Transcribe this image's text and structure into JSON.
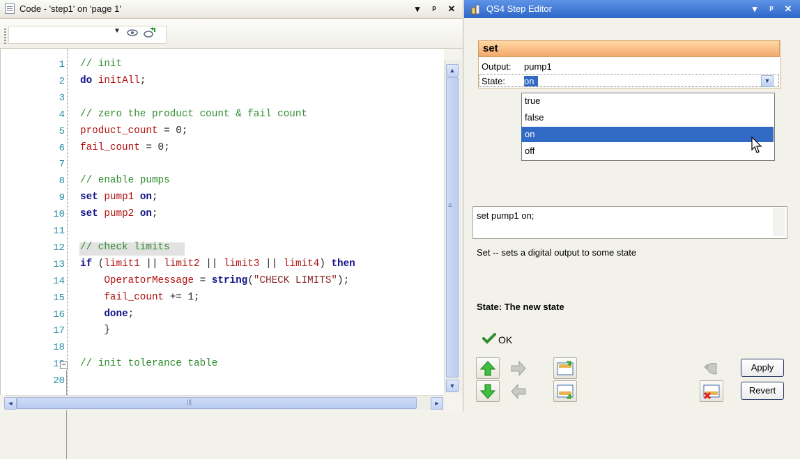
{
  "code_panel": {
    "title": "Code - 'step1' on 'page 1'",
    "window_buttons": {
      "menu": "▾",
      "pin": "ᵖ",
      "close": "✕"
    },
    "toolbar": {
      "combo_value": "",
      "combo_arrow": "▼",
      "view_icon": "view-icon",
      "refresh_icon": "refresh-icon"
    },
    "lines": [
      {
        "n": "1",
        "segments": [
          {
            "c": "cm",
            "t": "// init"
          }
        ]
      },
      {
        "n": "2",
        "segments": [
          {
            "c": "kw",
            "t": "do "
          },
          {
            "c": "id",
            "t": "initAll"
          },
          {
            "c": "op",
            "t": ";"
          }
        ]
      },
      {
        "n": "3",
        "segments": []
      },
      {
        "n": "4",
        "segments": [
          {
            "c": "cm",
            "t": "// zero the product count & fail count"
          }
        ]
      },
      {
        "n": "5",
        "segments": [
          {
            "c": "id",
            "t": "product_count"
          },
          {
            "c": "op",
            "t": " = 0;"
          }
        ]
      },
      {
        "n": "6",
        "segments": [
          {
            "c": "id",
            "t": "fail_count"
          },
          {
            "c": "op",
            "t": " = 0;"
          }
        ]
      },
      {
        "n": "7",
        "segments": []
      },
      {
        "n": "8",
        "segments": [
          {
            "c": "cm",
            "t": "// enable pumps"
          }
        ]
      },
      {
        "n": "9",
        "segments": [
          {
            "c": "kw",
            "t": "set "
          },
          {
            "c": "id",
            "t": "pump1"
          },
          {
            "c": "kw",
            "t": " on"
          },
          {
            "c": "op",
            "t": ";"
          }
        ]
      },
      {
        "n": "10",
        "segments": [
          {
            "c": "kw",
            "t": "set "
          },
          {
            "c": "id",
            "t": "pump2"
          },
          {
            "c": "kw",
            "t": " on"
          },
          {
            "c": "op",
            "t": ";"
          }
        ]
      },
      {
        "n": "11",
        "segments": []
      },
      {
        "n": "12",
        "segments": [
          {
            "c": "cm",
            "t": "// check limits"
          }
        ]
      },
      {
        "n": "13",
        "segments": [
          {
            "c": "kw",
            "t": "if "
          },
          {
            "c": "op",
            "t": "("
          },
          {
            "c": "id",
            "t": "limit1"
          },
          {
            "c": "op",
            "t": " || "
          },
          {
            "c": "id",
            "t": "limit2"
          },
          {
            "c": "op",
            "t": " || "
          },
          {
            "c": "id",
            "t": "limit3"
          },
          {
            "c": "op",
            "t": " || "
          },
          {
            "c": "id",
            "t": "limit4"
          },
          {
            "c": "op",
            "t": ") "
          },
          {
            "c": "kw",
            "t": "then"
          }
        ]
      },
      {
        "n": "14",
        "segments": [
          {
            "c": "op",
            "t": "    "
          },
          {
            "c": "id",
            "t": "OperatorMessage"
          },
          {
            "c": "op",
            "t": " = "
          },
          {
            "c": "kw",
            "t": "string"
          },
          {
            "c": "op",
            "t": "("
          },
          {
            "c": "str",
            "t": "\"CHECK LIMITS\""
          },
          {
            "c": "op",
            "t": ");"
          }
        ]
      },
      {
        "n": "15",
        "segments": [
          {
            "c": "op",
            "t": "    "
          },
          {
            "c": "id",
            "t": "fail_count"
          },
          {
            "c": "op",
            "t": " += 1;"
          }
        ]
      },
      {
        "n": "16",
        "segments": [
          {
            "c": "op",
            "t": "    "
          },
          {
            "c": "kw",
            "t": "done"
          },
          {
            "c": "op",
            "t": ";"
          }
        ]
      },
      {
        "n": "17",
        "segments": [
          {
            "c": "op",
            "t": "    }"
          }
        ]
      },
      {
        "n": "18",
        "segments": []
      },
      {
        "n": "19",
        "segments": [
          {
            "c": "cm",
            "t": "// init tolerance table"
          }
        ]
      },
      {
        "n": "20",
        "segments": []
      }
    ],
    "fold_marker": "−",
    "scroll": {
      "up": "▲",
      "down": "▼",
      "left": "◄",
      "right": "►",
      "grip": "≡",
      "hgrip": "|||"
    }
  },
  "step_editor": {
    "title": "QS4 Step Editor",
    "window_buttons": {
      "menu": "▾",
      "pin": "ᵖ",
      "close": "✕"
    },
    "step_name": "set",
    "properties": [
      {
        "label": "Output:",
        "value": "pump1"
      },
      {
        "label": "State:",
        "value": "on"
      }
    ],
    "dropdown_arrow": "▼",
    "options": [
      "true",
      "false",
      "on",
      "off"
    ],
    "selected_option": "on",
    "statement_text": "set pump1 on;",
    "help_text": "Set -- sets a digital output to some state",
    "parameter_help": "State: The new state",
    "status": "OK",
    "buttons": {
      "apply": "Apply",
      "revert": "Revert"
    },
    "colors": {
      "selection": "#316ac5",
      "title_bar": "#2f66c8",
      "header_orange": "#f3a86d"
    }
  }
}
